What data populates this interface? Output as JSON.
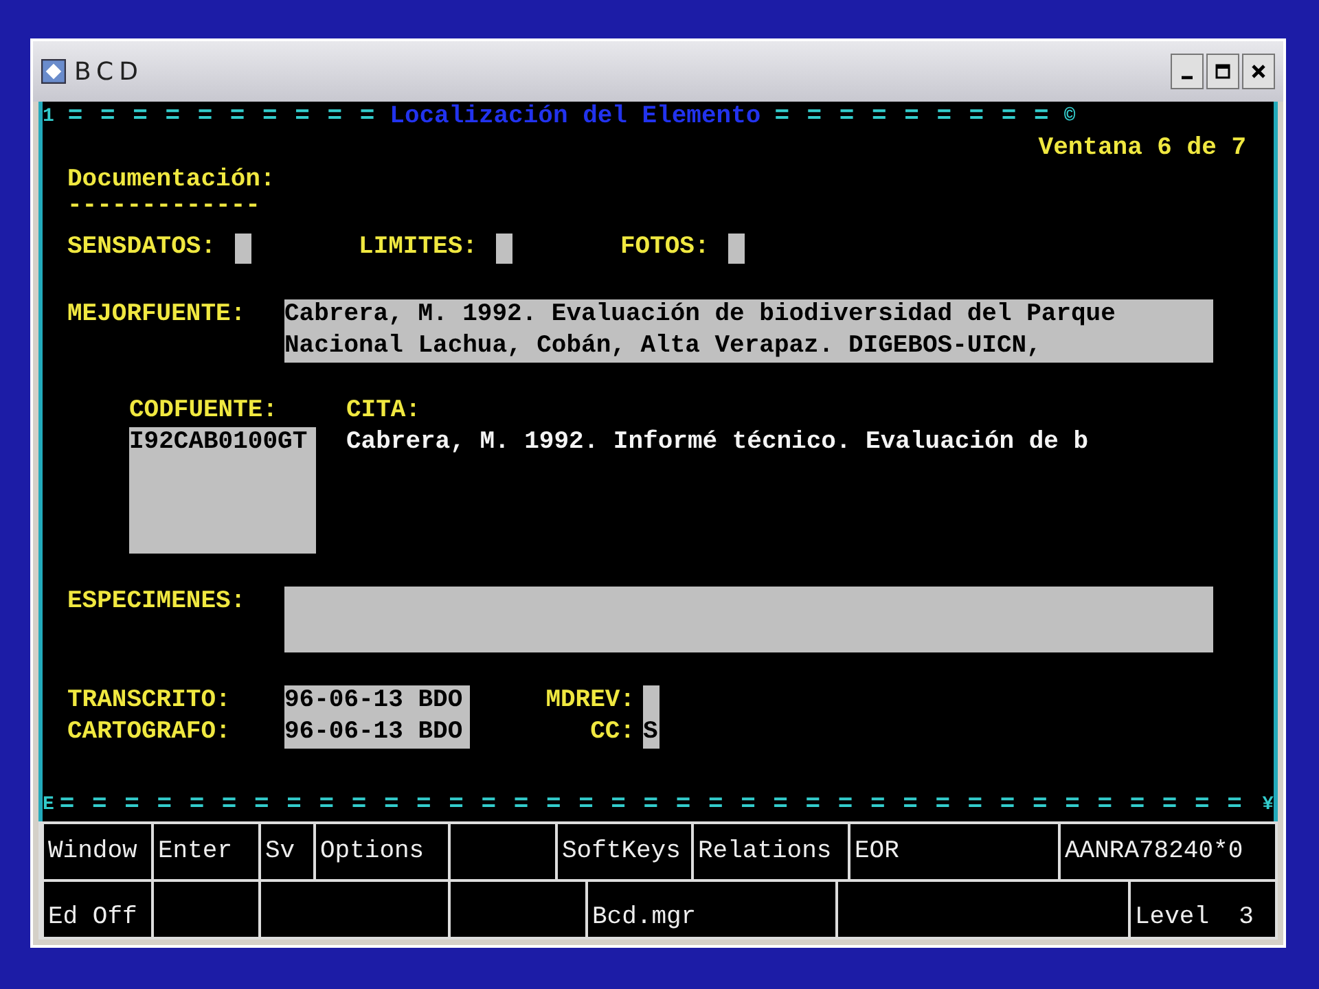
{
  "window": {
    "title": "BCD"
  },
  "screen": {
    "top_left_mark": "1",
    "top_right_mark": "©",
    "bottom_left_mark": "E",
    "bottom_right_mark": "¥",
    "rule_left": "= = = = = = = = = =",
    "title": "Localización del Elemento",
    "rule_right": "= = = = = = = = =",
    "bottom_rule": "= = = = = = = = = = = = = = = = = = = = = = = = = = = = = = = = = = = = =",
    "window_indicator": "Ventana 6 de 7",
    "section": {
      "title": "Documentación:",
      "underline": "-------------"
    },
    "flags": [
      {
        "label": "SENSDATOS:"
      },
      {
        "label": "LIMITES:"
      },
      {
        "label": "FOTOS:"
      }
    ],
    "mejorfuente": {
      "label": "MEJORFUENTE:",
      "lines": [
        "Cabrera, M. 1992. Evaluación de biodiversidad del Parque",
        "Nacional Lachua, Cobán, Alta Verapaz. DIGEBOS-UICN,"
      ]
    },
    "codfuente": {
      "label": "CODFUENTE:",
      "value": "I92CAB0100GT"
    },
    "cita": {
      "label": "CITA:",
      "value": "Cabrera, M. 1992. Informé técnico. Evaluación de b"
    },
    "especimenes": {
      "label": "ESPECIMENES:"
    },
    "transcrito": {
      "label": "TRANSCRITO:",
      "value": "96-06-13 BDO"
    },
    "cartografo": {
      "label": "CARTOGRAFO:",
      "value": "96-06-13 BDO"
    },
    "mdrev": {
      "label": "MDREV:"
    },
    "cc": {
      "label": "CC:",
      "value": "S"
    }
  },
  "softkeys": {
    "row_1": [
      "Window",
      "Enter",
      "Sv",
      "Options",
      "SoftKeys",
      "Relations",
      "EOR",
      "AANRA78240*0"
    ],
    "row_2": [
      "Ed Off",
      "Bcd.mgr",
      "Level  3"
    ]
  }
}
